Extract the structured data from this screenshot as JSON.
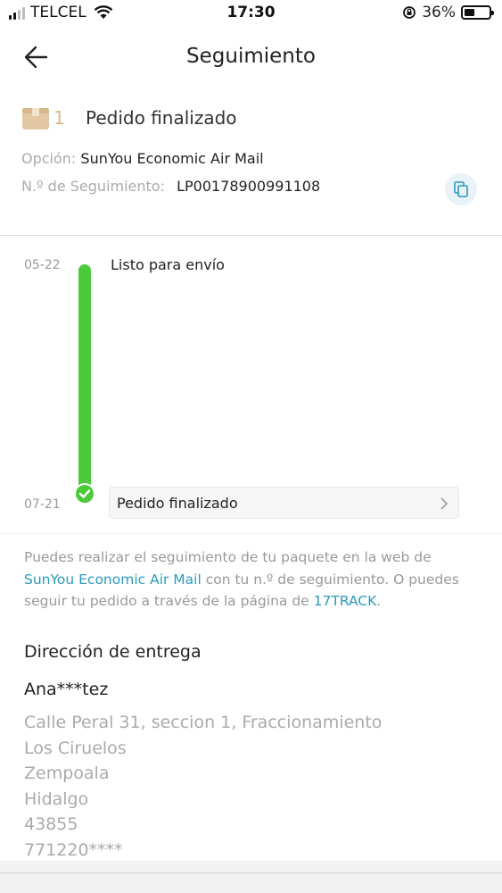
{
  "status_bar": {
    "carrier": "TELCEL",
    "time": "17:30",
    "battery": "36%"
  },
  "nav": {
    "title": "Seguimiento"
  },
  "order": {
    "count": "1",
    "status": "Pedido finalizado",
    "option_label": "Opción:",
    "option_value": "SunYou Economic Air Mail",
    "tracking_label": "N.º de Seguimiento:",
    "tracking_value": "LP00178900991108"
  },
  "timeline": {
    "events": [
      {
        "date": "05-22",
        "label": "Listo para envío"
      },
      {
        "date": "07-21",
        "label": "Pedido finalizado"
      }
    ]
  },
  "info": {
    "text1": "Puedes realizar el seguimiento de tu paquete en la web de ",
    "link1": "SunYou Economic Air Mail",
    "text2": " con tu n.º de seguimiento. O puedes seguir tu pedido a través de la página de ",
    "link2": "17TRACK",
    "text3": "."
  },
  "address": {
    "title": "Dirección de entrega",
    "name": "Ana***tez",
    "lines": [
      "Calle Peral 31, seccion 1, Fraccionamiento",
      "Los Ciruelos",
      "Zempoala",
      "Hidalgo",
      "43855",
      "771220****"
    ]
  },
  "colors": {
    "accent_green": "#4ccb3a",
    "link_blue": "#2a9bbd",
    "box_tan": "#d8b88a"
  }
}
